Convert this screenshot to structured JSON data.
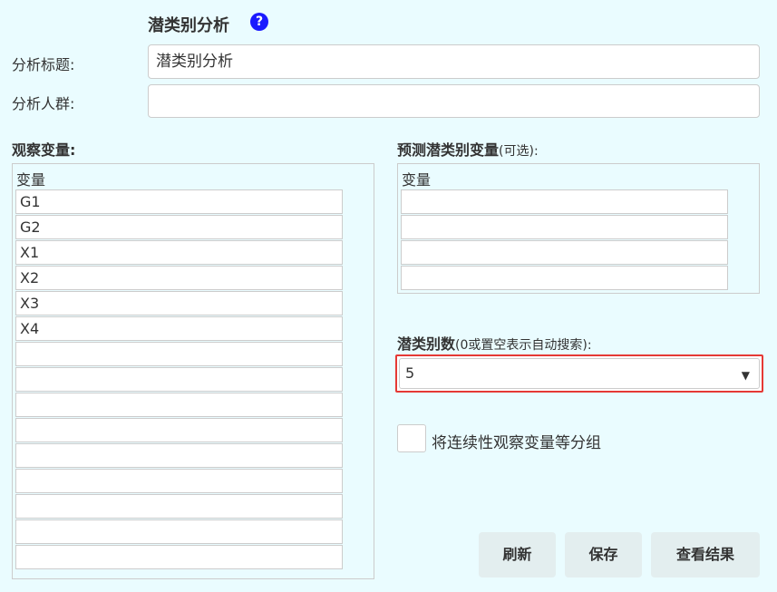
{
  "header": {
    "title": "潜类别分析",
    "help_icon": "question-circle-icon",
    "help_glyph": "?"
  },
  "form": {
    "analysis_title_label": "分析标题:",
    "analysis_title_value": "潜类别分析",
    "population_label": "分析人群:",
    "population_value": ""
  },
  "observed": {
    "label": "观察变量:",
    "column_header": "变量",
    "rows": [
      "G1",
      "G2",
      "X1",
      "X2",
      "X3",
      "X4",
      "",
      "",
      "",
      "",
      "",
      "",
      "",
      "",
      ""
    ]
  },
  "predictor": {
    "label": "预测潜类别变量",
    "label_suffix": "(可选):",
    "column_header": "变量",
    "rows": [
      "",
      "",
      "",
      ""
    ]
  },
  "class_count": {
    "label": "潜类别数",
    "label_suffix": "(0或置空表示自动搜索):",
    "selected": "5",
    "caret": "▼"
  },
  "equal_groups": {
    "label": "将连续性观察变量等分组",
    "checked": false
  },
  "buttons": {
    "refresh": "刷新",
    "save": "保存",
    "view_results": "查看结果"
  },
  "colors": {
    "background": "#eafcff",
    "accent_border": "#e53935",
    "help_icon": "#1a1aff",
    "button_bg": "#e3eeef"
  }
}
